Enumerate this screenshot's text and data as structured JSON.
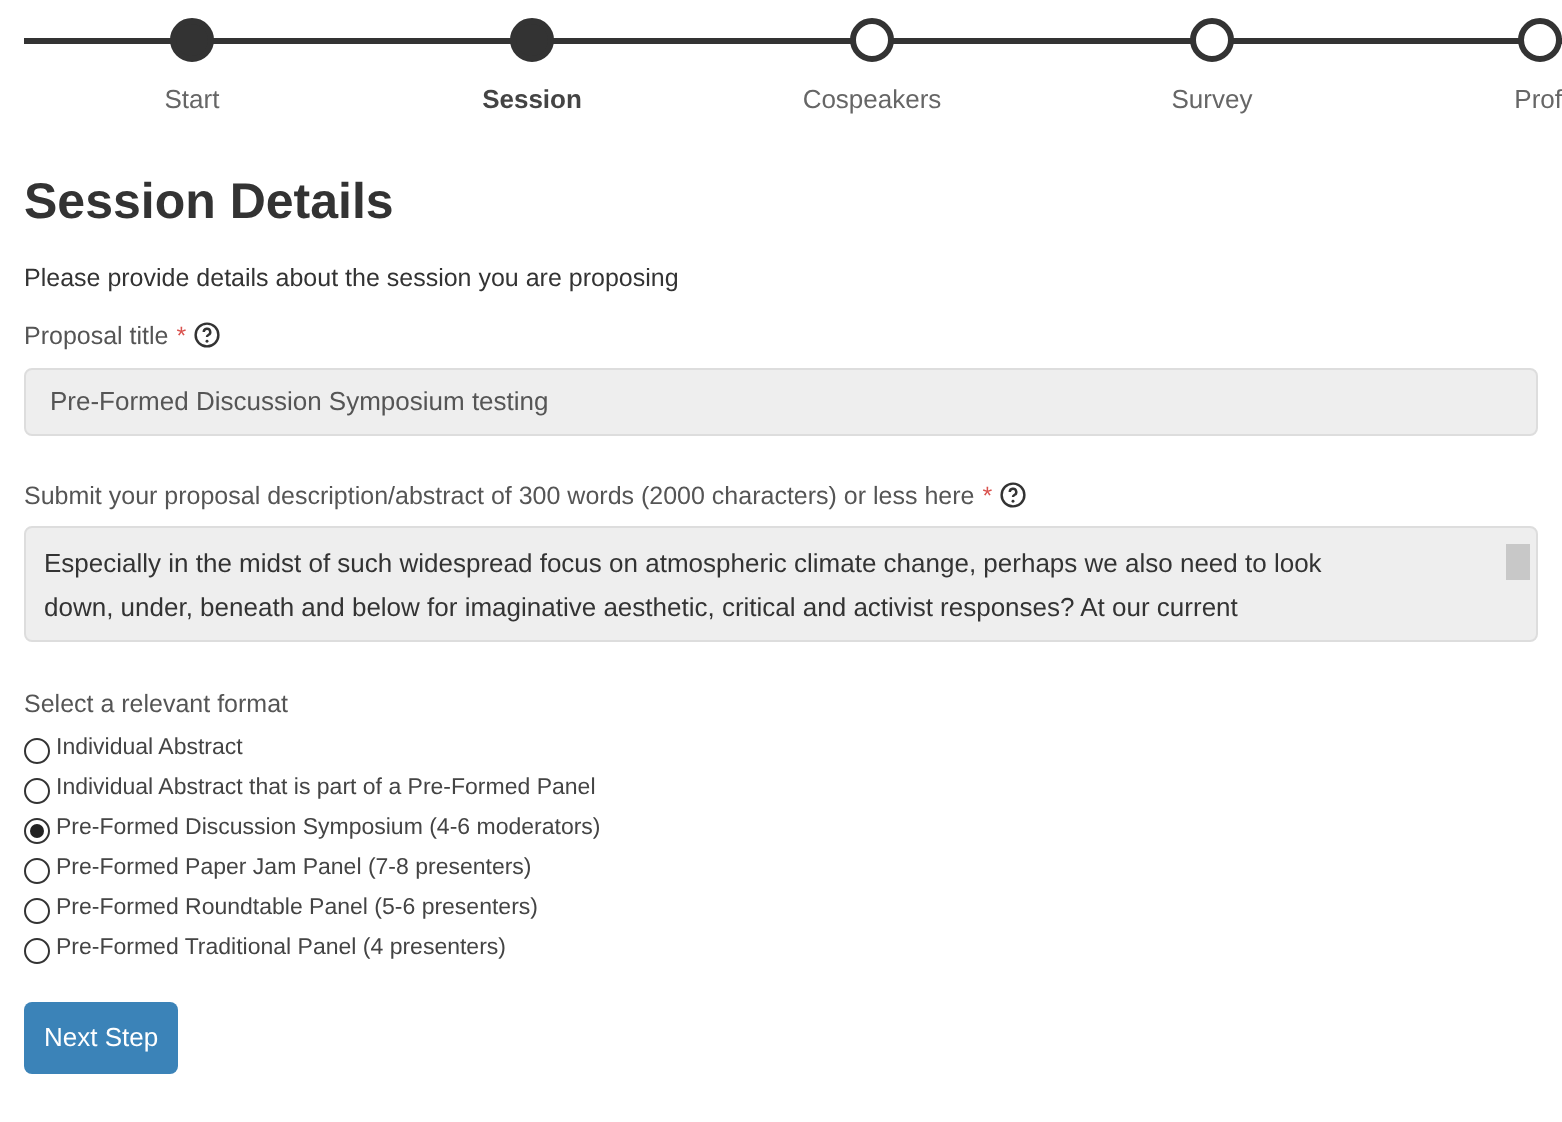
{
  "stepper": {
    "steps": [
      {
        "label": "Start",
        "done": true,
        "current": false
      },
      {
        "label": "Session",
        "done": true,
        "current": true
      },
      {
        "label": "Cospeakers",
        "done": false,
        "current": false
      },
      {
        "label": "Survey",
        "done": false,
        "current": false
      },
      {
        "label": "Prof",
        "done": false,
        "current": false
      }
    ]
  },
  "heading": "Session Details",
  "intro": "Please provide details about the session you are proposing",
  "title_field": {
    "label": "Proposal title",
    "required_mark": "*",
    "value": "Pre-Formed Discussion Symposium testing"
  },
  "abstract_field": {
    "label": "Submit your proposal description/abstract of 300 words (2000 characters) or less here",
    "required_mark": "*",
    "value_lines": [
      "Especially in the midst of such widespread focus on atmospheric climate change, perhaps we also need to look",
      "down, under, beneath and below for imaginative aesthetic, critical and activist responses? At our current"
    ]
  },
  "format": {
    "label": "Select a relevant format",
    "options": [
      {
        "label": "Individual Abstract",
        "selected": false
      },
      {
        "label": "Individual Abstract that is part of a Pre-Formed Panel",
        "selected": false
      },
      {
        "label": "Pre-Formed Discussion Symposium (4-6 moderators)",
        "selected": true
      },
      {
        "label": "Pre-Formed Paper Jam Panel (7-8 presenters)",
        "selected": false
      },
      {
        "label": "Pre-Formed Roundtable Panel (5-6 presenters)",
        "selected": false
      },
      {
        "label": "Pre-Formed Traditional Panel (4 presenters)",
        "selected": false
      }
    ]
  },
  "next_button": "Next Step"
}
